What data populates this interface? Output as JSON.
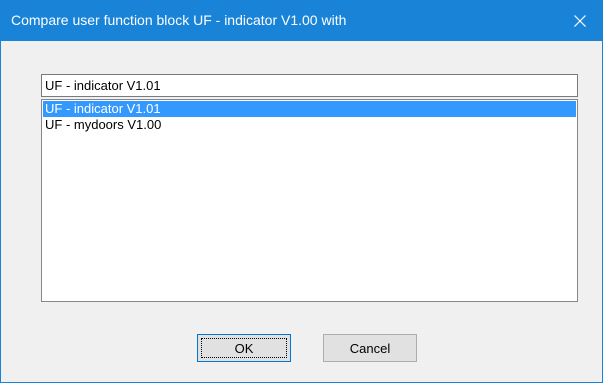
{
  "window": {
    "title": "Compare user function block UF - indicator V1.00 with",
    "accent_color": "#1883d7"
  },
  "combo": {
    "value": "UF - indicator V1.01"
  },
  "list": {
    "items": [
      {
        "label": "UF - indicator V1.01",
        "selected": true
      },
      {
        "label": "UF - mydoors V1.00",
        "selected": false
      }
    ],
    "selection_color": "#3399ff"
  },
  "buttons": {
    "ok_label": "OK",
    "cancel_label": "Cancel"
  },
  "icons": {
    "close": "close-icon"
  }
}
